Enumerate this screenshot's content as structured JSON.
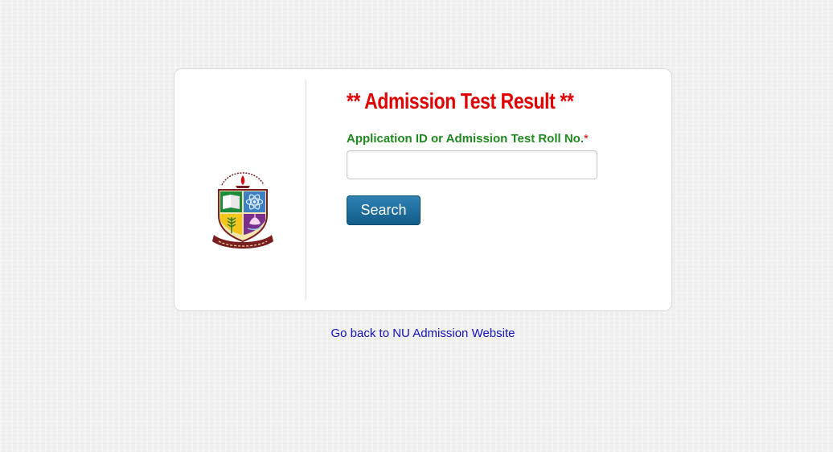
{
  "page": {
    "title": "** Admission Test Result **"
  },
  "form": {
    "field_label": "Application ID or Admission Test Roll No.",
    "required_marker": "*",
    "roll_value": "",
    "roll_placeholder": "",
    "search_label": "Search"
  },
  "footer": {
    "back_link": "Go back to NU Admission Website"
  },
  "logo": {
    "icon": "national-university-emblem-icon"
  },
  "colors": {
    "title": "#e00000",
    "label": "#1f8a1f",
    "button": "#1a6a99",
    "link": "#1212c0"
  }
}
